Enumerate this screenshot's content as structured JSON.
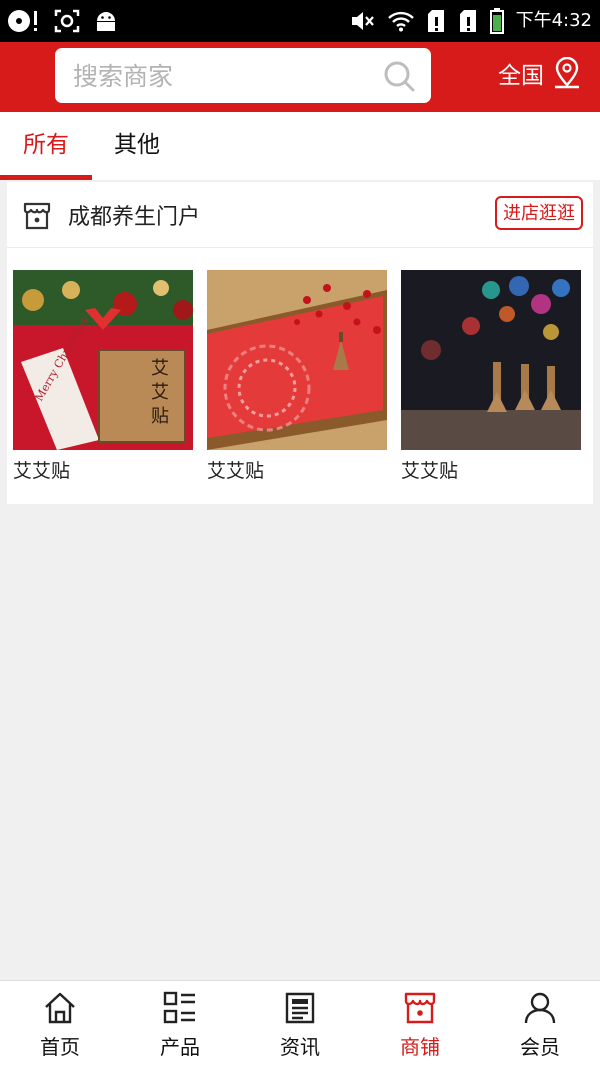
{
  "status_bar": {
    "time": "下午4:32",
    "icons": [
      "disc-icon",
      "alert-icon",
      "screenshot-icon",
      "android-icon",
      "mute-icon",
      "wifi-icon",
      "sim1-icon",
      "sim2-icon",
      "battery-icon"
    ]
  },
  "header": {
    "search_placeholder": "搜索商家",
    "region_label": "全国",
    "icons": [
      "search-icon",
      "location-pin-icon"
    ]
  },
  "tabs": [
    {
      "label": "所有",
      "active": true
    },
    {
      "label": "其他",
      "active": false
    }
  ],
  "store": {
    "name": "成都养生门户",
    "visit_button": "进店逛逛",
    "icon": "store-icon",
    "products": [
      {
        "name": "艾艾贴"
      },
      {
        "name": "艾艾贴"
      },
      {
        "name": "艾艾贴"
      }
    ]
  },
  "bottom_nav": [
    {
      "label": "首页",
      "icon": "home-icon",
      "active": false
    },
    {
      "label": "产品",
      "icon": "grid-list-icon",
      "active": false
    },
    {
      "label": "资讯",
      "icon": "news-icon",
      "active": false
    },
    {
      "label": "商铺",
      "icon": "shop-icon",
      "active": true
    },
    {
      "label": "会员",
      "icon": "user-icon",
      "active": false
    }
  ],
  "colors": {
    "brand": "#d71a1a",
    "status_bar": "#000000",
    "background": "#f0f0f0"
  }
}
